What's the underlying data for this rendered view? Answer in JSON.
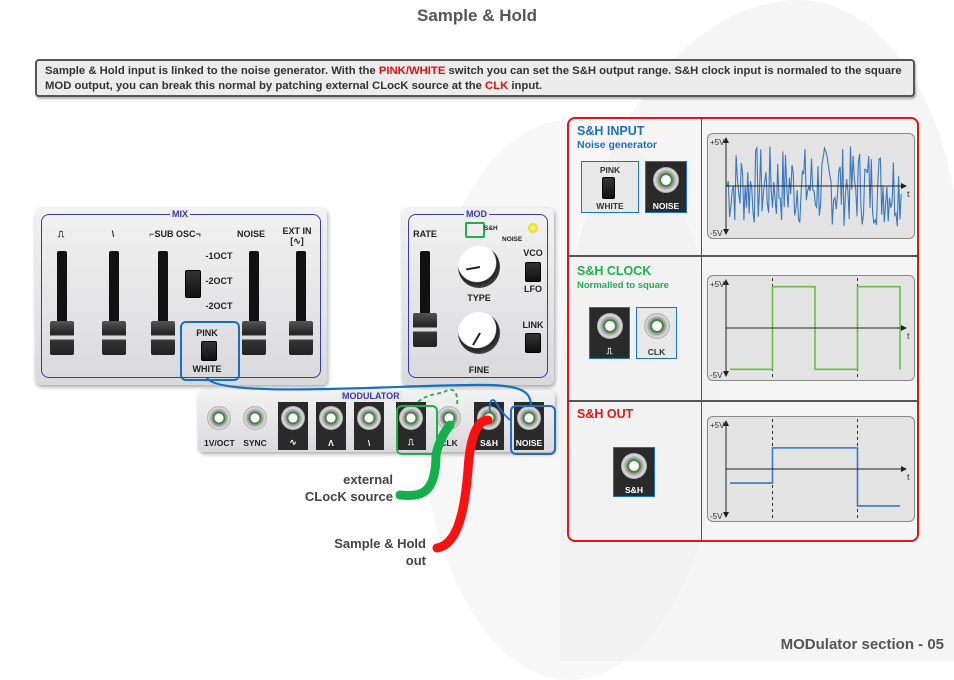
{
  "page": {
    "title": "Sample & Hold",
    "footer": "MODulator section - 05"
  },
  "description": {
    "part1": "Sample & Hold input is linked to the noise generator. With the ",
    "highlight1": "PINK/WHITE",
    "part2": " switch you can set the S&H output range. S&H clock input is normaled to the square MOD output, you can break this normal by patching external CLocK source at the ",
    "highlight2": "CLK",
    "part3": " input."
  },
  "mix_panel": {
    "section_label": "MIX",
    "columns": [
      "⎍",
      "⋌",
      "⌐SUB OSC¬",
      "NOISE",
      "EXT IN [∿]"
    ],
    "col1": "⎍",
    "col2": "\\",
    "col3": "⌐SUB OSC¬",
    "col4": "NOISE",
    "col5": "EXT IN",
    "col5b": "[∿]",
    "sub_osc_options": [
      "-1OCT",
      "-2OCT",
      "-2OCT"
    ],
    "pink_label": "PINK",
    "white_label": "WHITE"
  },
  "mod_panel": {
    "section_label": "MOD",
    "rate_label": "RATE",
    "sh_label": "S&H",
    "noise_label": "NOISE",
    "type_label": "TYPE",
    "fine_label": "FINE",
    "vco_label": "VCO",
    "lfo_label": "LFO",
    "link_label": "LINK"
  },
  "modulator_panel": {
    "section_label": "MODULATOR",
    "jacks": [
      {
        "label": "1V/OCT",
        "dark": false
      },
      {
        "label": "SYNC",
        "dark": false
      },
      {
        "label": "∿",
        "dark": true
      },
      {
        "label": "Λ",
        "dark": true
      },
      {
        "label": "\\",
        "dark": true
      },
      {
        "label": "⎍",
        "dark": true
      },
      {
        "label": "CLK",
        "dark": false
      },
      {
        "label": "S&H",
        "dark": true
      },
      {
        "label": "NOISE",
        "dark": true
      }
    ]
  },
  "callouts": {
    "clock_line1": "external",
    "clock_line2": "CLocK  source",
    "sh_line1": "Sample & Hold",
    "sh_line2": "out"
  },
  "info_table": {
    "rows": [
      {
        "title": "S&H INPUT",
        "subtitle": "Noise generator",
        "title_color": "#1a6fc2",
        "jacks": [
          "PINK/WHITE",
          "NOISE"
        ]
      },
      {
        "title": "S&H CLOCK",
        "subtitle": "Normalled to square",
        "title_color": "#1fb04a",
        "jacks": [
          "⎍",
          "CLK"
        ]
      },
      {
        "title": "S&H OUT",
        "subtitle": "",
        "title_color": "#e01515",
        "jacks": [
          "S&H"
        ]
      }
    ],
    "mini_pink": "PINK",
    "mini_white": "WHITE",
    "mini_noise": "NOISE",
    "mini_square": "⎍",
    "mini_clk": "CLK",
    "mini_sh": "S&H"
  },
  "colors": {
    "accent_red": "#e01515",
    "noise_blue": "#3a78c0",
    "clock_green": "#66c04a",
    "cable_green": "#14b04a",
    "cable_red": "#ff1010",
    "highlight_blue": "#1a6fc2"
  },
  "chart_data": [
    {
      "type": "line",
      "title": "S&H INPUT - Noise generator",
      "ylabel_top": "+5V",
      "ylabel_bottom": "-5V",
      "xlabel": "t",
      "ylim": [
        -5,
        5
      ],
      "description": "random noise spanning approximately -4.5V to +4.5V",
      "series": [
        {
          "name": "noise",
          "color": "#3a78c0",
          "values": "random"
        }
      ]
    },
    {
      "type": "line",
      "title": "S&H CLOCK - Normalled to square",
      "ylabel_top": "+5V",
      "ylabel_bottom": "-5V",
      "xlabel": "t",
      "ylim": [
        -5,
        5
      ],
      "x": [
        0,
        1,
        1,
        2,
        2,
        3,
        3,
        4,
        4
      ],
      "series": [
        {
          "name": "square",
          "color": "#66c04a",
          "values": [
            -4.7,
            -4.7,
            4.7,
            4.7,
            -4.7,
            -4.7,
            4.7,
            4.7,
            -4.7
          ]
        }
      ],
      "clock_edges": [
        1,
        3
      ]
    },
    {
      "type": "line",
      "title": "S&H OUT",
      "ylabel_top": "+5V",
      "ylabel_bottom": "-5V",
      "xlabel": "t",
      "ylim": [
        -5,
        5
      ],
      "x": [
        0,
        1,
        1,
        3,
        3,
        4
      ],
      "series": [
        {
          "name": "sh_out",
          "color": "#3a78c0",
          "values": [
            -1.6,
            -1.6,
            2.4,
            2.4,
            -4.2,
            -4.2
          ]
        }
      ],
      "clock_edges": [
        1,
        3
      ]
    }
  ]
}
